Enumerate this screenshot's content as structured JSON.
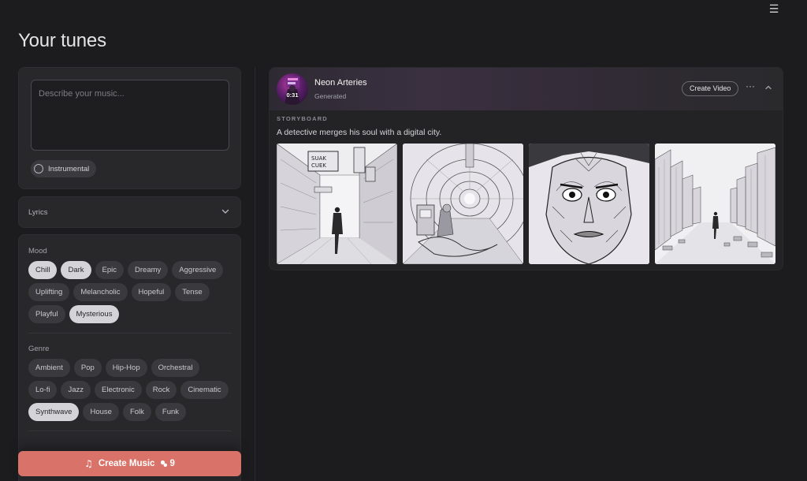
{
  "page": {
    "title": "Your tunes"
  },
  "prompt": {
    "placeholder": "Describe your music...",
    "value": ""
  },
  "instrumental": {
    "label": "Instrumental"
  },
  "lyrics": {
    "label": "Lyrics"
  },
  "mood": {
    "label": "Mood",
    "options": [
      "Chill",
      "Dark",
      "Epic",
      "Dreamy",
      "Aggressive",
      "Uplifting",
      "Melancholic",
      "Hopeful",
      "Tense",
      "Playful",
      "Mysterious"
    ],
    "selected": [
      "Chill",
      "Dark",
      "Mysterious"
    ]
  },
  "genre": {
    "label": "Genre",
    "options": [
      "Ambient",
      "Pop",
      "Hip-Hop",
      "Orchestral",
      "Lo-fi",
      "Jazz",
      "Electronic",
      "Rock",
      "Cinematic",
      "Synthwave",
      "House",
      "Folk",
      "Funk"
    ],
    "selected": [
      "Synthwave"
    ]
  },
  "create_button": {
    "label": "Create Music",
    "credits": "9",
    "icon": "music-note-icon",
    "credit_icon": "credit-icon"
  },
  "track": {
    "title": "Neon Arteries",
    "status": "Generated",
    "duration": "0:31",
    "create_video_label": "Create Video",
    "storyboard_label": "STORYBOARD",
    "storyboard_caption": "A detective merges his soul with a digital city.",
    "frames": [
      "alley-scene",
      "tunnel-scene",
      "face-portrait",
      "city-street-scene"
    ]
  },
  "colors": {
    "accent": "#d9736a",
    "background": "#1c1c1e",
    "card": "#28282b",
    "chip": "#3a3a3e",
    "chip_selected": "#d4d4d8"
  }
}
